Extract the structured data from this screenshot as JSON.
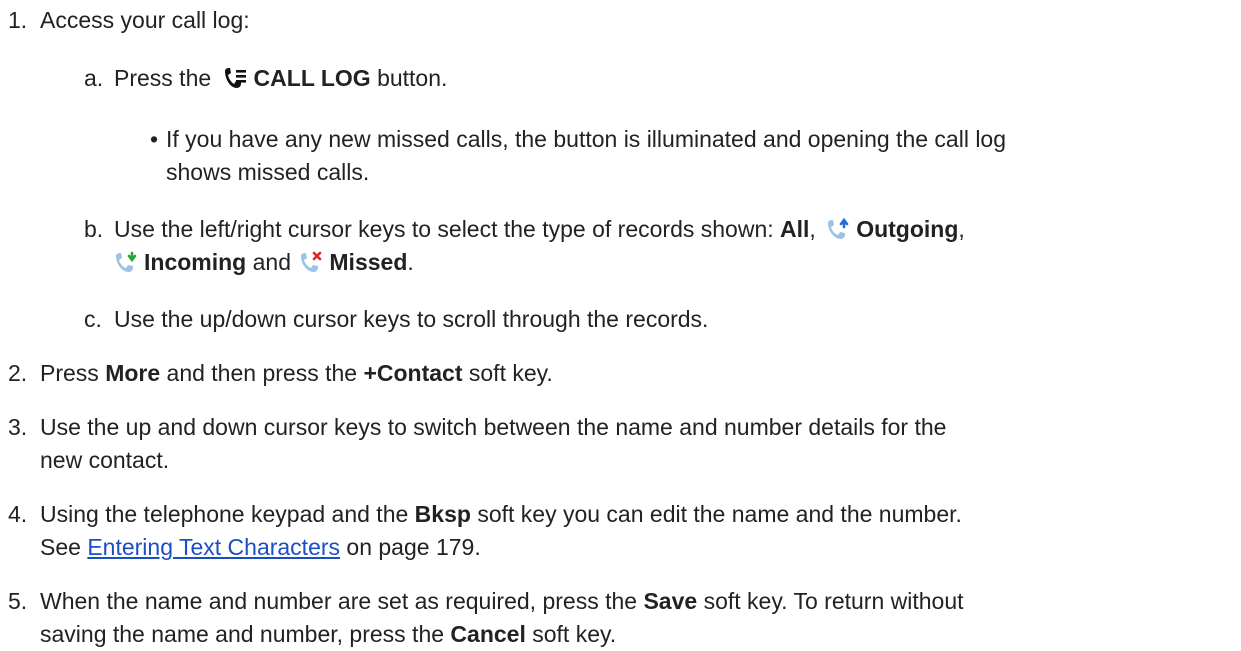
{
  "steps": {
    "s1": {
      "num": "1.",
      "text": "Access your call log:"
    },
    "s1a": {
      "num": "a.",
      "pre": "Press the",
      "btn": "CALL LOG",
      "post": "button."
    },
    "s1a_bullet": {
      "mark": "•",
      "line1": "If you have any new missed calls, the button is illuminated and opening the call log",
      "line2": "shows missed calls."
    },
    "s1b": {
      "num": "b.",
      "pre": "Use the left/right cursor keys to select the type of records shown:",
      "all": "All",
      "comma1": ",",
      "outgoing": "Outgoing",
      "comma2": ",",
      "incoming": "Incoming",
      "and": "and",
      "missed": "Missed",
      "end": "."
    },
    "s1c": {
      "num": "c.",
      "text": "Use the up/down cursor keys to scroll through the records."
    },
    "s2": {
      "num": "2.",
      "pre": "Press",
      "more": "More",
      "mid": "and then press the",
      "contact": "+Contact",
      "post": "soft key."
    },
    "s3": {
      "num": "3.",
      "line1": "Use the up and down cursor keys to switch between the name and number details for the",
      "line2": "new contact."
    },
    "s4": {
      "num": "4.",
      "pre": "Using the telephone keypad and the",
      "bksp": "Bksp",
      "post": "soft key you can edit the name and the number.",
      "see": "See",
      "link": "Entering Text Characters",
      "page": "on page 179."
    },
    "s5": {
      "num": "5.",
      "pre": "When the name and number are set as required, press the",
      "save": "Save",
      "mid": "soft key. To return without",
      "line2pre": "saving the name and number, press the",
      "cancel": "Cancel",
      "post": "soft key."
    }
  },
  "icons": {
    "call_log": "call-log-icon",
    "outgoing": "outgoing-call-icon",
    "incoming": "incoming-call-icon",
    "missed": "missed-call-icon"
  },
  "colors": {
    "link": "#1a4fc4",
    "phone_icon": "#9cc3e6",
    "outgoing_arrow": "#1e6fd9",
    "incoming_arrow": "#27a33a",
    "missed_x": "#e02424"
  }
}
